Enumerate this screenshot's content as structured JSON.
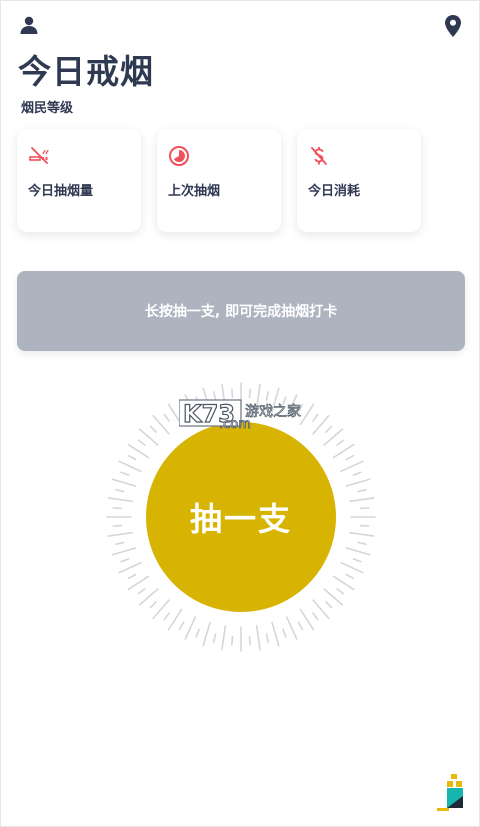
{
  "header": {
    "title": "今日戒烟",
    "level_label": "烟民等级"
  },
  "icons": {
    "user": "user-icon",
    "location": "location-pin-icon",
    "no_smoking": "no-smoking-icon",
    "timer": "clock-icon",
    "cost": "dollar-off-icon"
  },
  "cards": [
    {
      "label": "今日抽烟量"
    },
    {
      "label": "上次抽烟"
    },
    {
      "label": "今日消耗"
    }
  ],
  "checkin": {
    "label": "长按抽一支, 即可完成抽烟打卡"
  },
  "smoke_button": {
    "label": "抽一支"
  },
  "watermark": {
    "brand": "K73",
    "site": ".com",
    "text": "游戏之家"
  },
  "colors": {
    "accent_red": "#f0505a",
    "title_dark": "#2f3a52",
    "button_gold": "#d8b402",
    "banner_gray": "#adb3bf"
  }
}
